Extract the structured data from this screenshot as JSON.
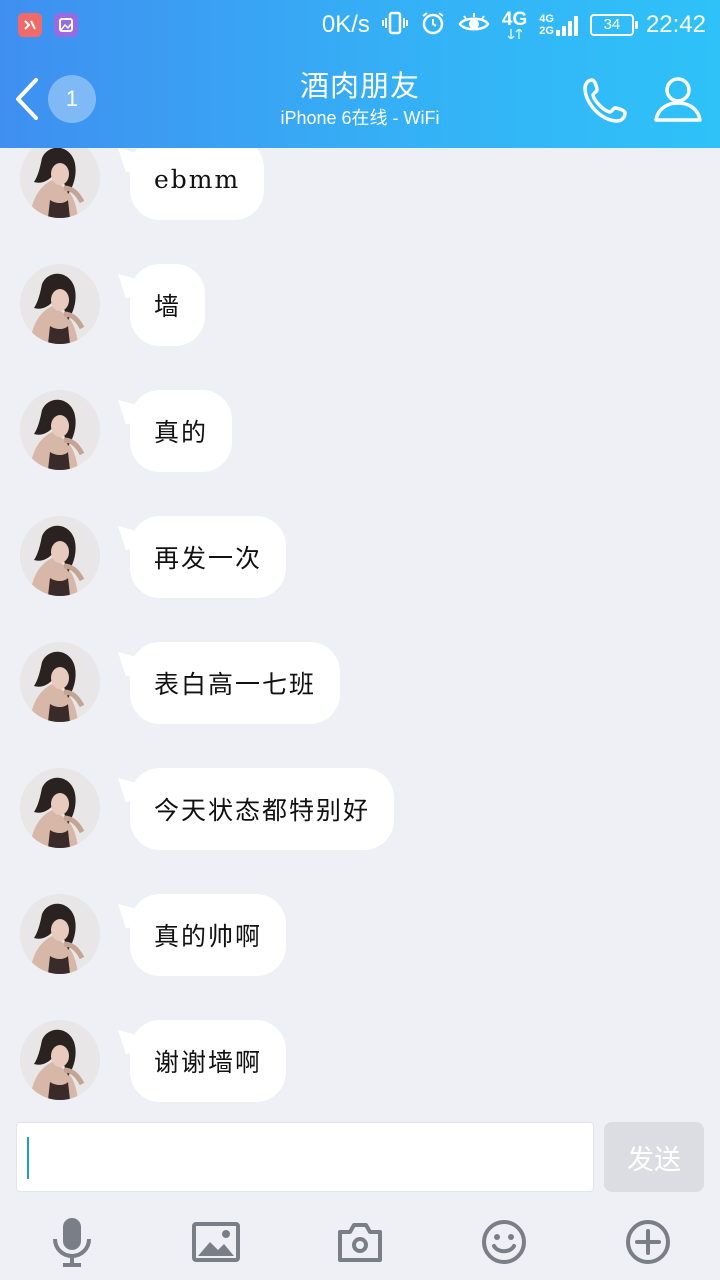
{
  "status_bar": {
    "speed": "0K/s",
    "net_4g": "4G",
    "net_small_top": "4G",
    "net_small_bottom": "2G",
    "battery": "34",
    "time": "22:42"
  },
  "header": {
    "back_badge": "1",
    "title": "酒肉朋友",
    "subtitle": "iPhone 6在线 - WiFi"
  },
  "messages": [
    {
      "text": "ebmm"
    },
    {
      "text": "墙"
    },
    {
      "text": "真的"
    },
    {
      "text": "再发一次"
    },
    {
      "text": "表白高一七班"
    },
    {
      "text": "今天状态都特别好"
    },
    {
      "text": "真的帅啊"
    },
    {
      "text": "谢谢墙啊"
    }
  ],
  "composer": {
    "input_value": "",
    "send_label": "发送"
  },
  "colors": {
    "header_gradient_start": "#3f8ff0",
    "header_gradient_end": "#2ec2f8",
    "chat_background": "#eff0f5",
    "bubble": "#ffffff",
    "send_disabled": "#dcdde2",
    "icon_gray": "#7a7e87"
  }
}
